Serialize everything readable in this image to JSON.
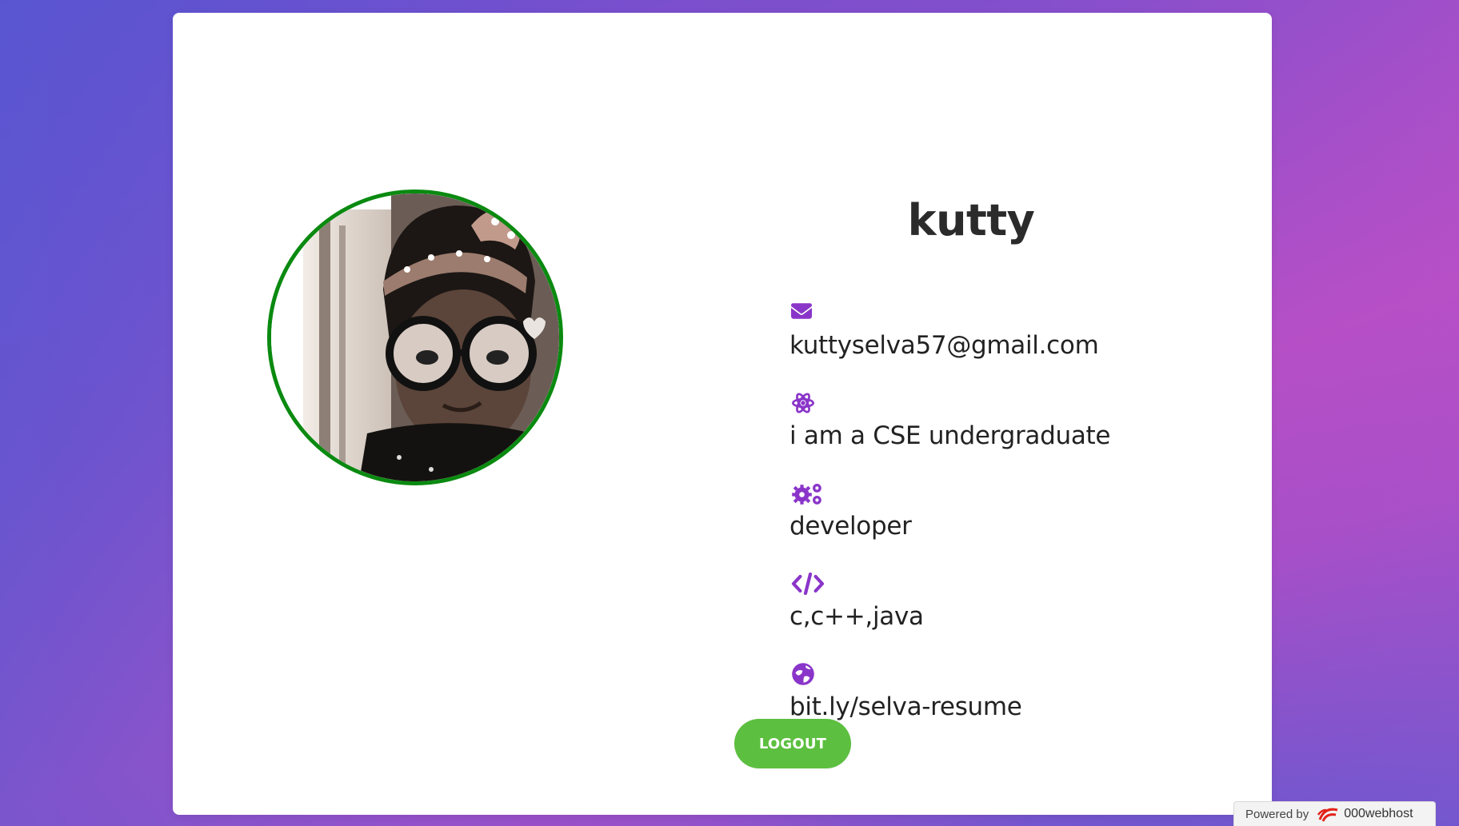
{
  "profile": {
    "name": "kutty",
    "avatar_icon": "profile-photo"
  },
  "info": [
    {
      "icon": "envelope-icon",
      "text": "kuttyselva57@gmail.com"
    },
    {
      "icon": "atom-icon",
      "text": "i am a CSE undergraduate"
    },
    {
      "icon": "gears-icon",
      "text": "developer"
    },
    {
      "icon": "code-icon",
      "text": "c,c++,java"
    },
    {
      "icon": "globe-icon",
      "text": "bit.ly/selva-resume"
    }
  ],
  "actions": {
    "logout_label": "LOGOUT"
  },
  "footer": {
    "powered_label": "Powered by",
    "brand_label": "000webhost"
  },
  "colors": {
    "accent": "#8a35c9",
    "logout": "#5cbf3f",
    "avatar_border": "#0a8a10",
    "gradient_left": "#4d5bd2",
    "gradient_right": "#c24fc6"
  }
}
